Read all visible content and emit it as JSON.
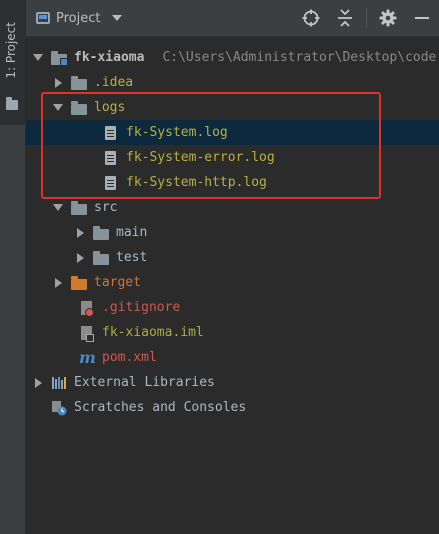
{
  "tool_strip": {
    "tab_label": "1: Project"
  },
  "header": {
    "title": "Project",
    "actions": [
      "locate-icon",
      "collapse-icon",
      "gear-icon",
      "minimize-icon"
    ]
  },
  "tree": {
    "root": {
      "name": "fk-xiaoma",
      "path": "C:\\Users\\Administrator\\Desktop\\code"
    },
    "idea": ".idea",
    "logs": {
      "name": "logs",
      "files": [
        "fk-System.log",
        "fk-System-error.log",
        "fk-System-http.log"
      ]
    },
    "src": {
      "name": "src",
      "children": [
        "main",
        "test"
      ]
    },
    "target": "target",
    "gitignore": ".gitignore",
    "iml": "fk-xiaoma.iml",
    "pom": "pom.xml",
    "external_libraries": "External Libraries",
    "scratches": "Scratches and Consoles"
  },
  "colors": {
    "background": "#2b2b2b",
    "header": "#3c3f41",
    "selected_row": "#0d293e",
    "highlight_border": "#e0302a",
    "ignored_text": "#b8b13f",
    "excluded_text": "#cc7832",
    "untracked_text": "#d0584d"
  }
}
